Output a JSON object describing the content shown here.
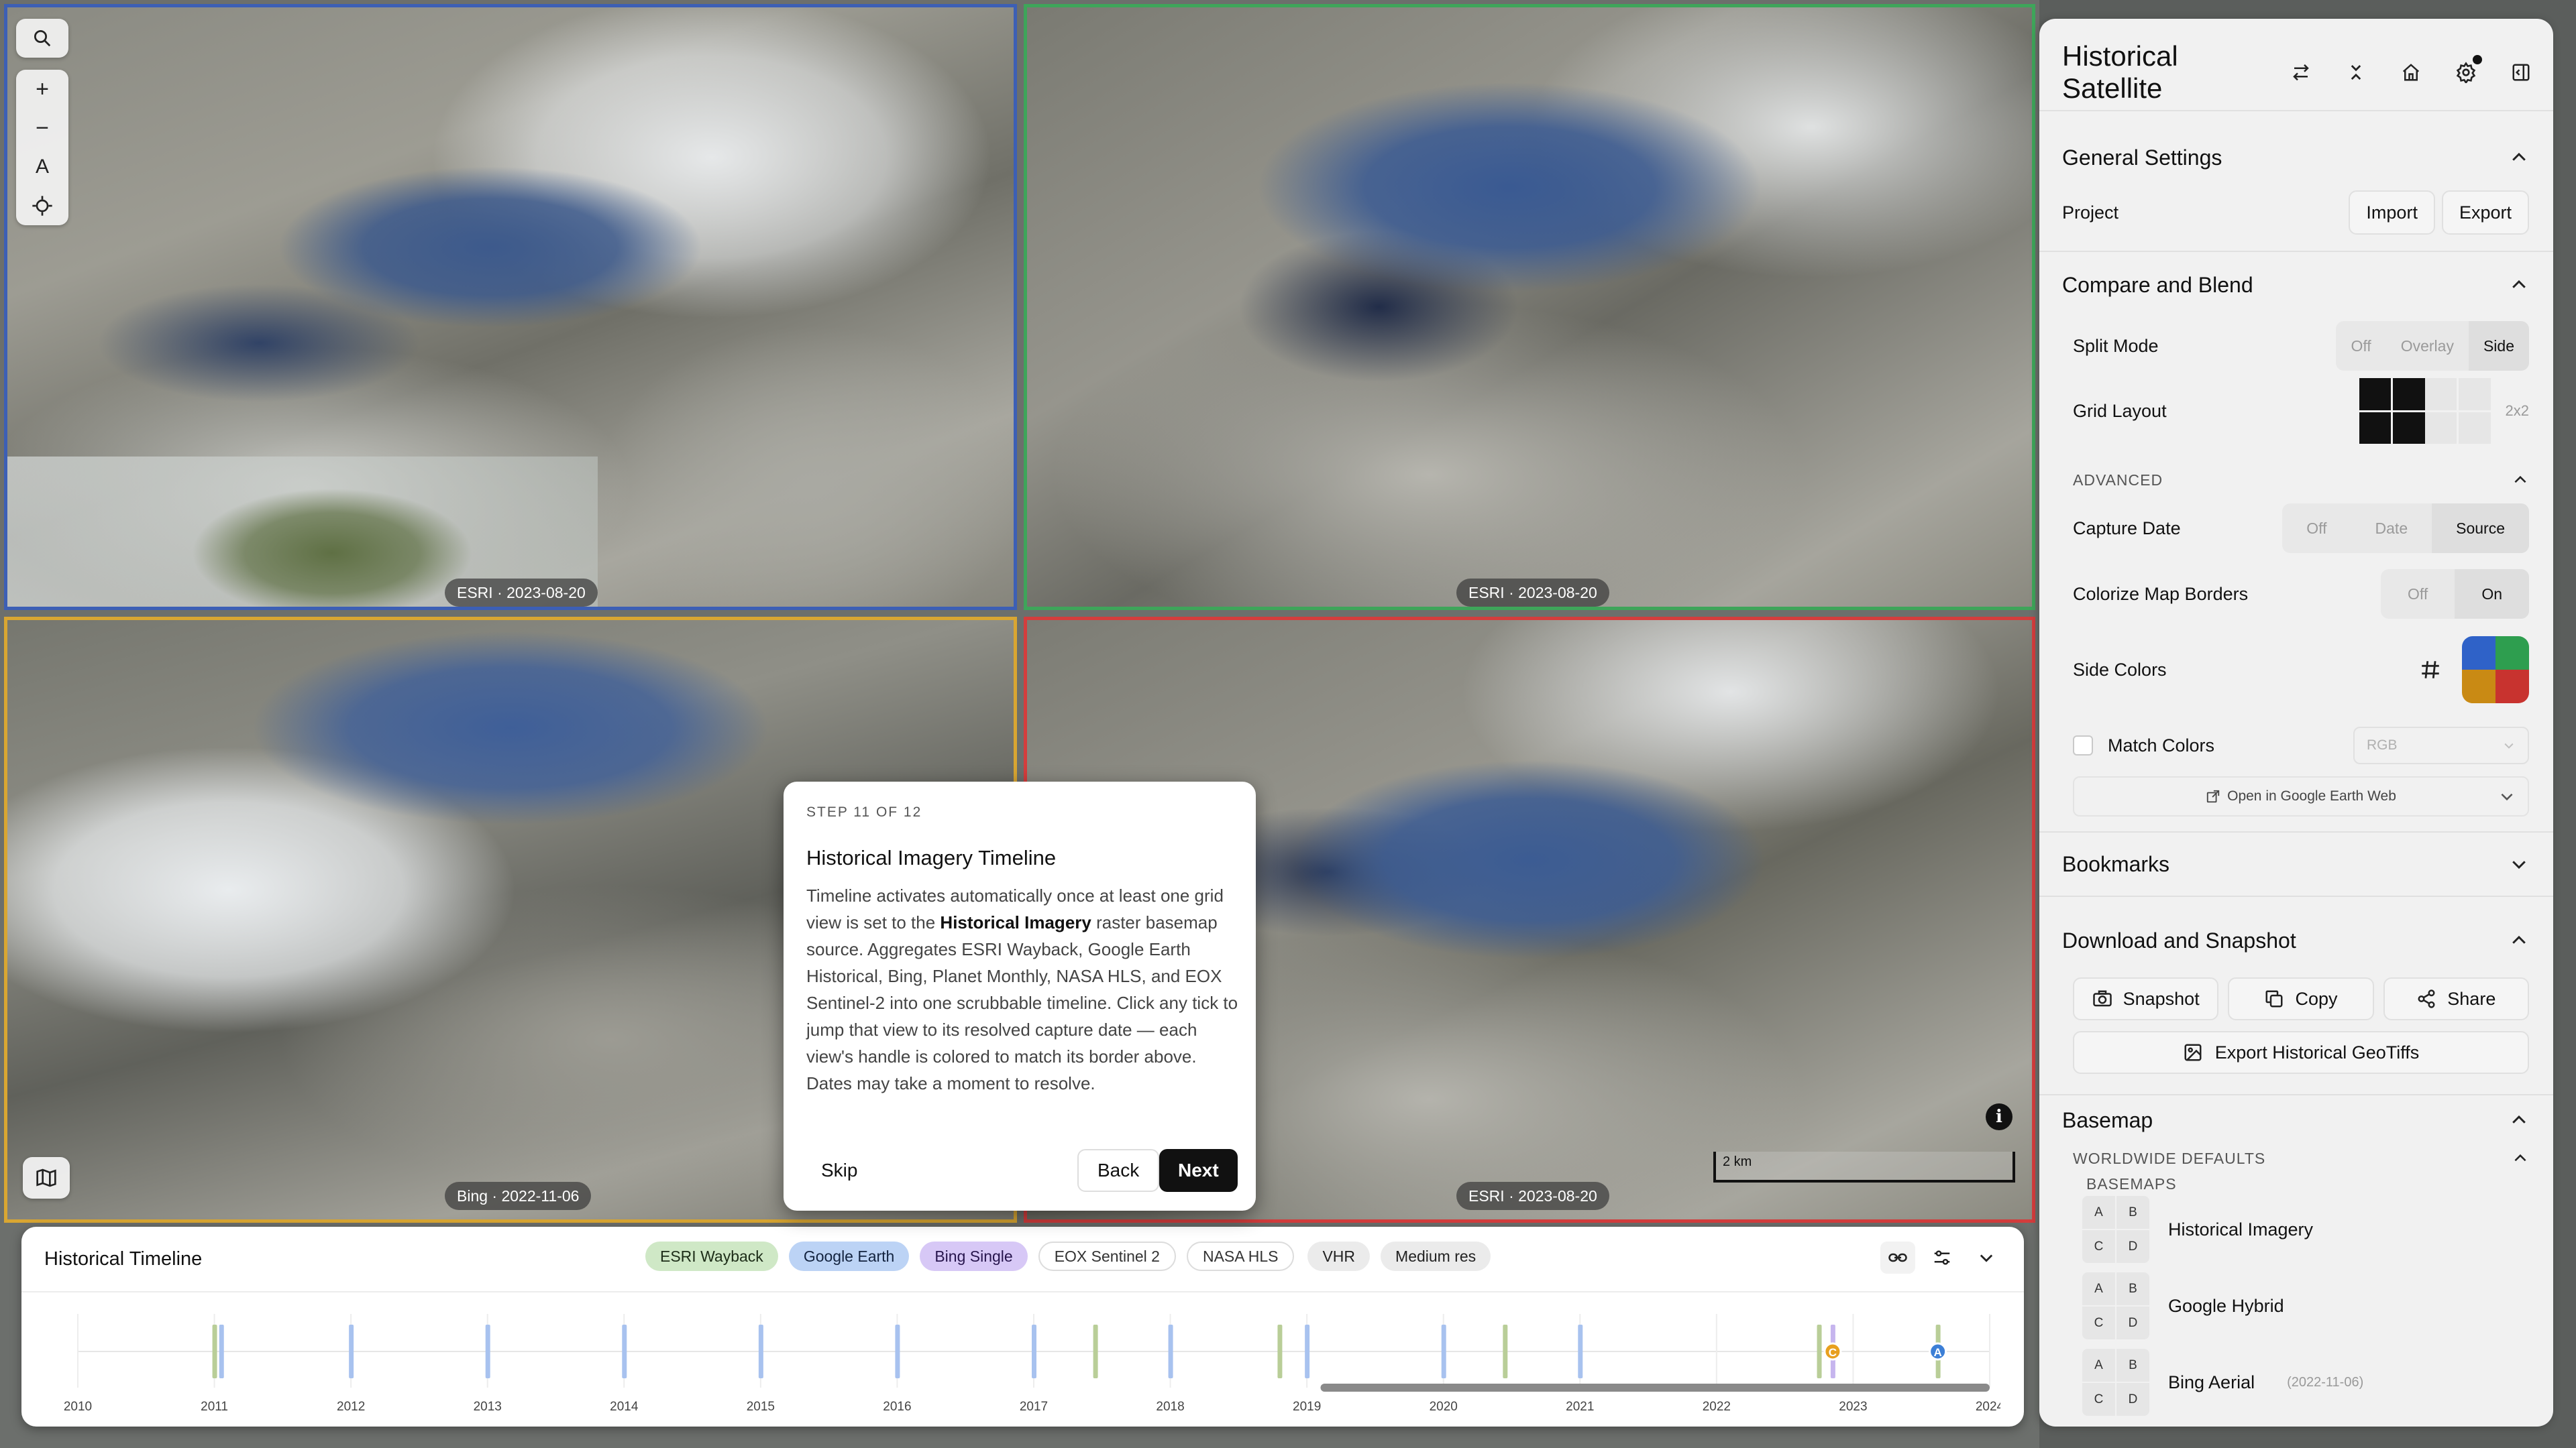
{
  "map": {
    "views": [
      {
        "id": "tl",
        "badge": "ESRI · 2023-08-20",
        "border": "#3c5fb5"
      },
      {
        "id": "tr",
        "badge": "ESRI · 2023-08-20",
        "border": "#3ea55a"
      },
      {
        "id": "bl",
        "badge": "Bing · 2022-11-06",
        "border": "#d9a632"
      },
      {
        "id": "br",
        "badge": "ESRI · 2023-08-20",
        "border": "#d43d3d"
      }
    ],
    "tools": {
      "search": "search-icon",
      "zoom_in": "+",
      "zoom_out": "−",
      "north": "A",
      "locate": "crosshair-icon"
    },
    "scale": "2 km",
    "info": "i"
  },
  "tour": {
    "step": "STEP 11 OF 12",
    "title": "Historical Imagery Timeline",
    "body_1": "Timeline activates automatically once at least one grid view is set to the ",
    "body_bold": "Historical Imagery",
    "body_2": " raster basemap source. Aggregates ESRI Wayback, Google Earth Historical, Bing, Planet Monthly, NASA HLS, and EOX Sentinel-2 into one scrubbable timeline. Click any tick to jump that view to its resolved capture date — each view's handle is colored to match its border above. Dates may take a moment to resolve.",
    "skip": "Skip",
    "back": "Back",
    "next": "Next"
  },
  "timeline": {
    "title": "Historical Timeline",
    "chips": [
      "ESRI Wayback",
      "Google Earth",
      "Bing Single",
      "EOX Sentinel 2",
      "NASA HLS",
      "VHR",
      "Medium res"
    ],
    "years": [
      "2010",
      "2011",
      "2012",
      "2013",
      "2014",
      "2015",
      "2016",
      "2017",
      "2018",
      "2019",
      "2020",
      "2021",
      "2022",
      "2023",
      "2024"
    ],
    "ticks": [
      {
        "year": 2011.0,
        "color": "#b9ce98"
      },
      {
        "year": 2011.05,
        "color": "#a8c2ef"
      },
      {
        "year": 2012.0,
        "color": "#a8c2ef"
      },
      {
        "year": 2013.0,
        "color": "#a8c2ef"
      },
      {
        "year": 2014.0,
        "color": "#a8c2ef"
      },
      {
        "year": 2015.0,
        "color": "#a8c2ef"
      },
      {
        "year": 2016.0,
        "color": "#a8c2ef"
      },
      {
        "year": 2017.0,
        "color": "#a8c2ef"
      },
      {
        "year": 2017.45,
        "color": "#b9ce98"
      },
      {
        "year": 2018.0,
        "color": "#a8c2ef"
      },
      {
        "year": 2018.8,
        "color": "#b9ce98"
      },
      {
        "year": 2019.0,
        "color": "#a8c2ef"
      },
      {
        "year": 2020.0,
        "color": "#a8c2ef"
      },
      {
        "year": 2020.45,
        "color": "#b9ce98"
      },
      {
        "year": 2021.0,
        "color": "#a8c2ef"
      },
      {
        "year": 2022.75,
        "color": "#b9ce98"
      },
      {
        "year": 2022.85,
        "color": "#c6b5ee"
      },
      {
        "year": 2023.62,
        "color": "#b9ce98"
      }
    ],
    "handles": [
      {
        "year": 2022.85,
        "label": "C",
        "color": "#e8a020"
      },
      {
        "year": 2023.62,
        "label": "A",
        "color": "#3c7fd6"
      }
    ],
    "range_start_year": 2019.1
  },
  "sidebar": {
    "title": "Historical Satellite",
    "general": {
      "title": "General Settings",
      "project_label": "Project",
      "import": "Import",
      "export": "Export"
    },
    "compare": {
      "title": "Compare and Blend",
      "split_mode": {
        "label": "Split Mode",
        "options": [
          "Off",
          "Overlay",
          "Side"
        ],
        "selected": "Side"
      },
      "grid_layout": {
        "label": "Grid Layout",
        "value": "2x2"
      },
      "advanced": "ADVANCED",
      "capture_date": {
        "label": "Capture Date",
        "options": [
          "Off",
          "Date",
          "Source"
        ],
        "selected": "Source"
      },
      "colorize": {
        "label": "Colorize Map Borders",
        "options": [
          "Off",
          "On"
        ],
        "selected": "On"
      },
      "side_colors": {
        "label": "Side Colors",
        "colors": [
          "#2f62c8",
          "#2e9e4f",
          "#c98a14",
          "#c8332f"
        ]
      },
      "match_colors": {
        "label": "Match Colors",
        "select": "RGB"
      },
      "open_link": "Open in Google Earth Web"
    },
    "bookmarks": {
      "title": "Bookmarks"
    },
    "download": {
      "title": "Download and Snapshot",
      "snapshot": "Snapshot",
      "copy": "Copy",
      "share": "Share",
      "export_geotiffs": "Export Historical GeoTiffs"
    },
    "basemap": {
      "title": "Basemap",
      "worldwide": "WORLDWIDE DEFAULTS",
      "basemaps": "BASEMAPS",
      "items": [
        {
          "name": "Historical Imagery",
          "sub": ""
        },
        {
          "name": "Google Hybrid",
          "sub": ""
        },
        {
          "name": "Bing Aerial",
          "sub": "(2022-11-06)"
        }
      ],
      "quad": [
        "A",
        "B",
        "C",
        "D"
      ]
    }
  }
}
